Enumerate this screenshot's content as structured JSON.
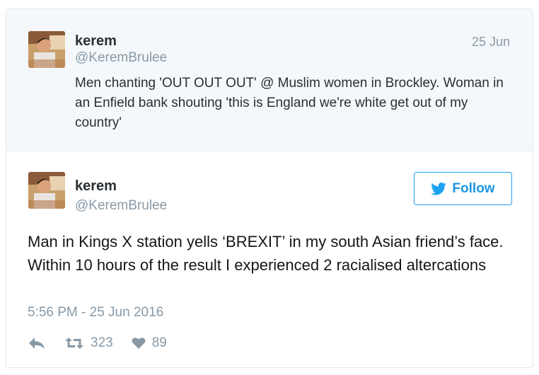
{
  "quoted_tweet": {
    "name": "kerem",
    "handle": "@KeremBrulee",
    "date": "25 Jun",
    "text": "Men chanting 'OUT OUT OUT' @ Muslim women in Brockley. Woman in an Enfield bank shouting 'this is England we're white get out of my country'"
  },
  "main_tweet": {
    "name": "kerem",
    "handle": "@KeremBrulee",
    "follow_label": "Follow",
    "text": "Man in Kings X station yells ‘BREXIT’ in my south Asian friend’s face. Within 10 hours of the result I experienced 2 racialised altercations",
    "timestamp": "5:56 PM - 25 Jun 2016",
    "retweet_count": "323",
    "like_count": "89"
  },
  "icons": {
    "reply": "reply-icon",
    "retweet": "retweet-icon",
    "like": "heart-icon",
    "follow": "twitter-bird-icon"
  },
  "colors": {
    "accent": "#1da1f2",
    "muted": "#8899a6",
    "quoted_bg": "#f5f8fa"
  }
}
